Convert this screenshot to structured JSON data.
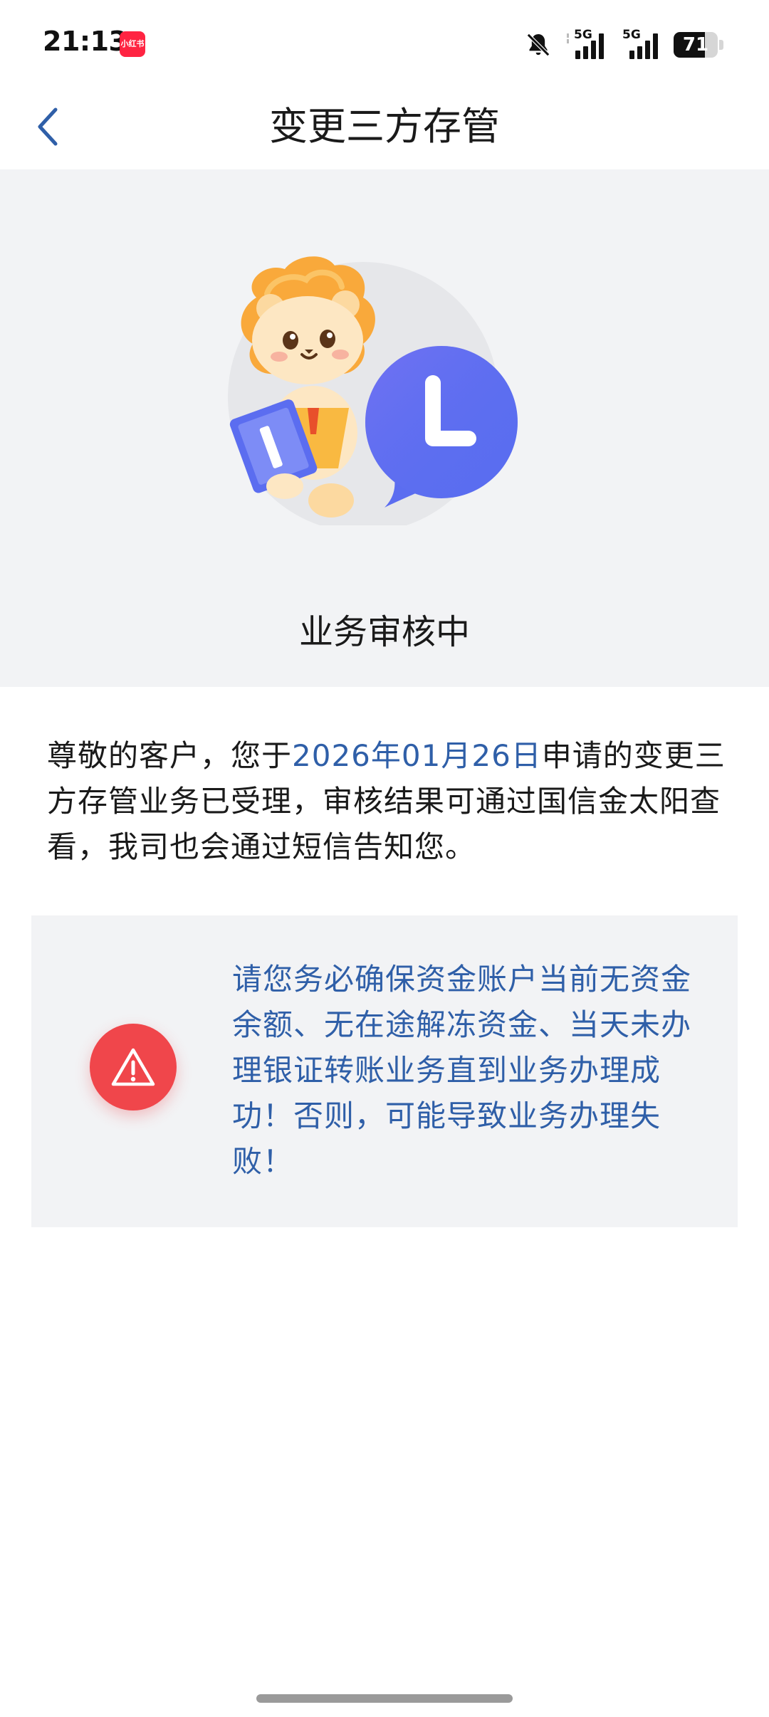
{
  "status_bar": {
    "time": "21:13",
    "app_badge": "小红书",
    "icons": [
      "bell-muted-icon",
      "signal-5g-icon",
      "signal-5g-icon",
      "battery-icon"
    ],
    "network_1": "5G",
    "network_2": "5G",
    "battery_level": "71",
    "battery_fraction": 0.71
  },
  "nav": {
    "back_icon": "chevron-left-icon",
    "title": "变更三方存管"
  },
  "hero": {
    "illustration": "lion-mascot-with-clock-icon",
    "status": "业务审核中"
  },
  "message": {
    "prefix": "尊敬的客户，您于",
    "date": "2026年01月26日",
    "suffix": "申请的变更三方存管业务已受理，审核结果可通过国信金太阳查看，我司也会通过短信告知您。"
  },
  "warning": {
    "icon": "warning-triangle-icon",
    "text": "请您务必确保资金账户当前无资金余额、无在途解冻资金、当天未办理银证转账业务直到业务办理成功！否则，可能导致业务办理失败！"
  },
  "colors": {
    "accent_blue": "#2f5fa8",
    "warning_red": "#f0464b",
    "hero_bg": "#f2f3f5",
    "clock_blue": "#5b6df0"
  }
}
